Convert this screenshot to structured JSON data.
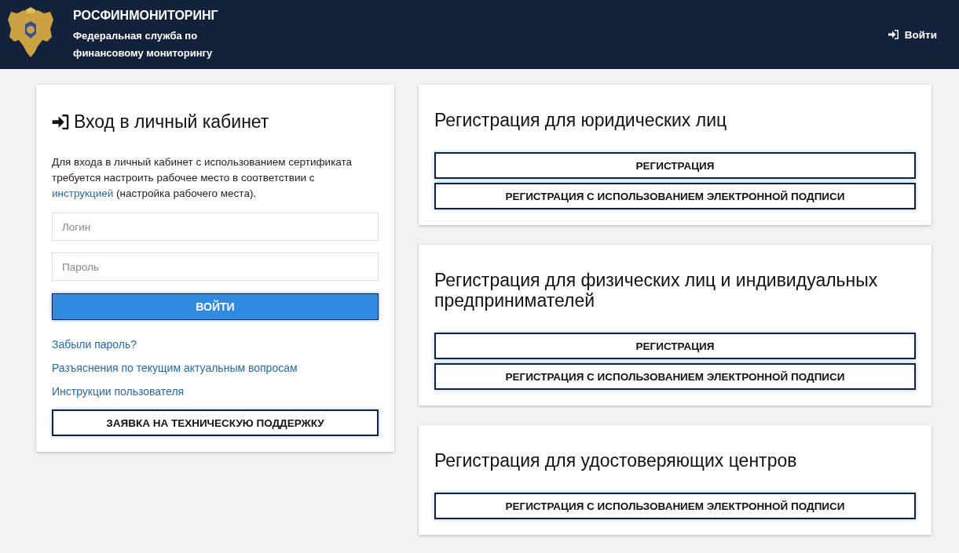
{
  "header": {
    "title": "РОСФИНМОНИТОРИНГ",
    "subtitle": [
      "Федеральная служба по",
      "финансовому мониторингу"
    ],
    "login_link": "Войти"
  },
  "login_card": {
    "title": "Вход в личный кабинет",
    "note_before": "Для входа в личный кабинет с использованием сертификата требуется настроить рабочее место в соответствии с ",
    "note_link": "инструкцией",
    "note_after": " (настройка рабочего места).",
    "fields": [
      {
        "placeholder": "Логин"
      },
      {
        "placeholder": "Пароль"
      }
    ],
    "submit": "ВОЙТИ",
    "links": [
      "Забыли пароль?",
      "Разъяснения по текущим актуальным вопросам",
      "Инструкции пользователя"
    ],
    "support_button": "ЗАЯВКА НА ТЕХНИЧЕСКУЮ ПОДДЕРЖКУ"
  },
  "registration_cards": [
    {
      "title": "Регистрация для юридических лиц",
      "buttons": [
        "РЕГИСТРАЦИЯ",
        "РЕГИСТРАЦИЯ С ИСПОЛЬЗОВАНИЕМ ЭЛЕКТРОННОЙ ПОДПИСИ"
      ]
    },
    {
      "title": "Регистрация для физических лиц и индивидуальных предпринимателей",
      "buttons": [
        "РЕГИСТРАЦИЯ",
        "РЕГИСТРАЦИЯ С ИСПОЛЬЗОВАНИЕМ ЭЛЕКТРОННОЙ ПОДПИСИ"
      ]
    },
    {
      "title": "Регистрация для удостоверяющих центров",
      "buttons": [
        "РЕГИСТРАЦИЯ С ИСПОЛЬЗОВАНИЕМ ЭЛЕКТРОННОЙ ПОДПИСИ"
      ]
    }
  ]
}
